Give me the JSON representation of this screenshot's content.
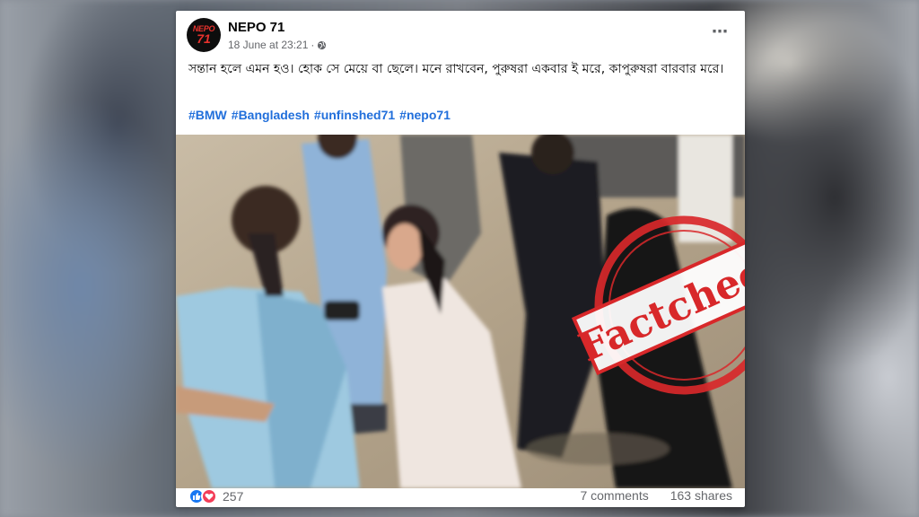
{
  "post": {
    "page_name": "NEPO 71",
    "avatar_text_top": "NEPO",
    "avatar_text_bottom": "71",
    "timestamp": "18 June at 23:21",
    "dot": "·",
    "more_icon": "⋯",
    "caption": "সন্তান হলে এমন হও। হোক সে মেয়ে বা ছেলে। মনে রাখবেন, পুরুষরা একবার ই মরে, কাপুরুষরা বারবার মরে।",
    "hashtags": [
      "#BMW",
      "#Bangladesh",
      "#unfinshed71",
      "#nepo71"
    ],
    "stamp_text": "Factcheck",
    "reaction_count": "257",
    "comments": "7 comments",
    "shares": "163 shares"
  },
  "colors": {
    "link": "#216fdb",
    "stamp_red": "#d8282a",
    "like_blue": "#1877f2",
    "love_red": "#f33e58"
  },
  "icons": [
    "globe-icon",
    "more-icon",
    "like-icon",
    "love-icon"
  ]
}
